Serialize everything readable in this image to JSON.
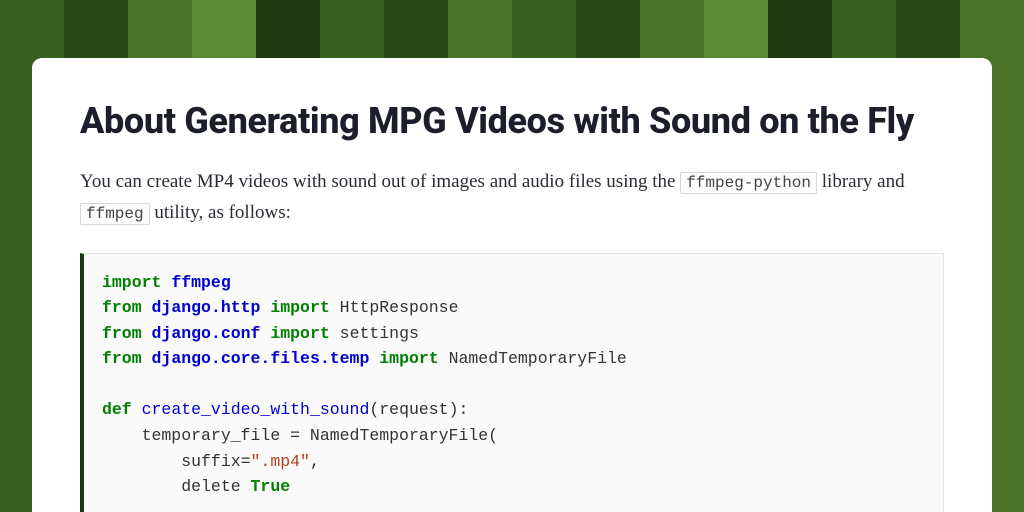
{
  "title": "About Generating MPG Videos with Sound on the Fly",
  "intro": {
    "part1": "You can create MP4 videos with sound out of images and audio files using the ",
    "code1": "ffmpeg-python",
    "part2": " library and ",
    "code2": "ffmpeg",
    "part3": " utility, as follows:"
  },
  "code": {
    "l1_kw1": "import",
    "l1_nn1": "ffmpeg",
    "l2_kw1": "from",
    "l2_nn1": "django.http",
    "l2_kw2": "import",
    "l2_nm1": " HttpResponse",
    "l3_kw1": "from",
    "l3_nn1": "django.conf",
    "l3_kw2": "import",
    "l3_nm1": " settings",
    "l4_kw1": "from",
    "l4_nn1": "django.core.files.temp",
    "l4_kw2": "import",
    "l4_nm1": " NamedTemporaryFile",
    "l6_kw1": "def",
    "l6_fn1": "create_video_with_sound",
    "l6_tx1": "(request):",
    "l7_tx1": "    temporary_file = NamedTemporaryFile(",
    "l8_tx1": "        suffix=",
    "l8_str1": "\".mp4\"",
    "l8_tx2": ",",
    "l9_tx1": "        delete ",
    "l9_kw1": "True"
  }
}
